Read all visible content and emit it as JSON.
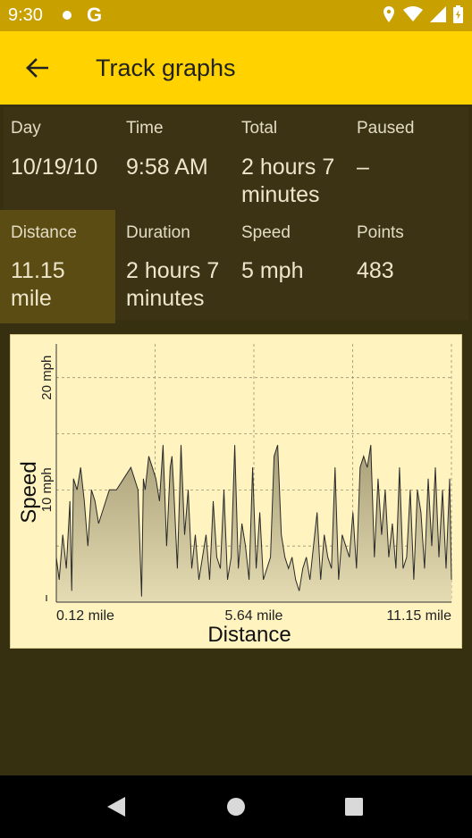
{
  "status_bar": {
    "time": "9:30",
    "g_label": "G"
  },
  "app_bar": {
    "title": "Track graphs"
  },
  "stats": [
    {
      "label": "Day",
      "value": "10/19/10"
    },
    {
      "label": "Time",
      "value": "9:58 AM"
    },
    {
      "label": "Total",
      "value": "2 hours 7 minutes"
    },
    {
      "label": "Paused",
      "value": "–"
    },
    {
      "label": "Distance",
      "value": "11.15 mile"
    },
    {
      "label": "Duration",
      "value": "2 hours 7 minutes"
    },
    {
      "label": "Speed",
      "value": "5 mph"
    },
    {
      "label": "Points",
      "value": "483"
    }
  ],
  "chart_data": {
    "type": "area",
    "xlabel": "Distance",
    "ylabel": "Speed",
    "x_ticks": [
      "0.12 mile",
      "5.64 mile",
      "11.15 mile"
    ],
    "y_ticks": [
      "10 mph",
      "20 mph"
    ],
    "xlim": [
      0.12,
      11.15
    ],
    "ylim": [
      0,
      23
    ],
    "grid": true,
    "fill_color": "#c7bd96",
    "line_color": "#2a2a2a",
    "x": [
      0.12,
      0.2,
      0.3,
      0.4,
      0.5,
      0.55,
      0.6,
      0.7,
      0.8,
      0.9,
      1.0,
      1.1,
      1.2,
      1.3,
      1.4,
      1.5,
      1.6,
      1.8,
      2.0,
      2.2,
      2.4,
      2.5,
      2.55,
      2.6,
      2.7,
      2.8,
      2.9,
      3.0,
      3.1,
      3.2,
      3.3,
      3.35,
      3.4,
      3.5,
      3.6,
      3.7,
      3.8,
      3.9,
      4.0,
      4.1,
      4.2,
      4.3,
      4.4,
      4.5,
      4.6,
      4.7,
      4.8,
      4.9,
      5.0,
      5.1,
      5.2,
      5.3,
      5.4,
      5.5,
      5.6,
      5.7,
      5.8,
      5.9,
      6.0,
      6.1,
      6.2,
      6.3,
      6.4,
      6.5,
      6.6,
      6.7,
      6.8,
      6.9,
      7.0,
      7.1,
      7.2,
      7.3,
      7.4,
      7.5,
      7.6,
      7.7,
      7.8,
      7.9,
      8.0,
      8.1,
      8.2,
      8.3,
      8.4,
      8.5,
      8.6,
      8.7,
      8.8,
      8.9,
      9.0,
      9.1,
      9.2,
      9.3,
      9.4,
      9.5,
      9.6,
      9.7,
      9.8,
      9.9,
      10.0,
      10.1,
      10.2,
      10.3,
      10.4,
      10.5,
      10.6,
      10.7,
      10.8,
      10.9,
      11.0,
      11.1,
      11.15
    ],
    "y": [
      4,
      2,
      6,
      3,
      9,
      1,
      11,
      10,
      12,
      9,
      5,
      10,
      9,
      7,
      8,
      9,
      10,
      10,
      11,
      12,
      10,
      0.5,
      11,
      10,
      13,
      12,
      11,
      9,
      14,
      5,
      12,
      13,
      10,
      3,
      14,
      6,
      10,
      3,
      6,
      2,
      4,
      6,
      2,
      9,
      4,
      3,
      10,
      2,
      4,
      14,
      3,
      7,
      5,
      2,
      12,
      3,
      8,
      2,
      3,
      4,
      13,
      14,
      6,
      4,
      3,
      4,
      2,
      1,
      3,
      4,
      2,
      5,
      8,
      2,
      6,
      4,
      3,
      12,
      2,
      6,
      5,
      4,
      8,
      3,
      12,
      13,
      12,
      14,
      4,
      11,
      6,
      10,
      4,
      7,
      3,
      12,
      3,
      4,
      10,
      2,
      10,
      8,
      3,
      11,
      5,
      12,
      4,
      10,
      3,
      11,
      2
    ],
    "values_note": "approximate"
  }
}
